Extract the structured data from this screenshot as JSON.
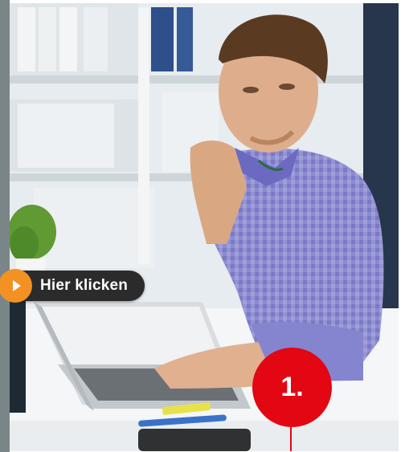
{
  "cta": {
    "label": "Hier klicken",
    "icon": "arrow-right-icon",
    "color": "#2b2b2b",
    "accent": "#f39122"
  },
  "step": {
    "label": "1.",
    "color": "#e30613"
  },
  "photo": {
    "icon": "man-at-laptop-photo"
  }
}
